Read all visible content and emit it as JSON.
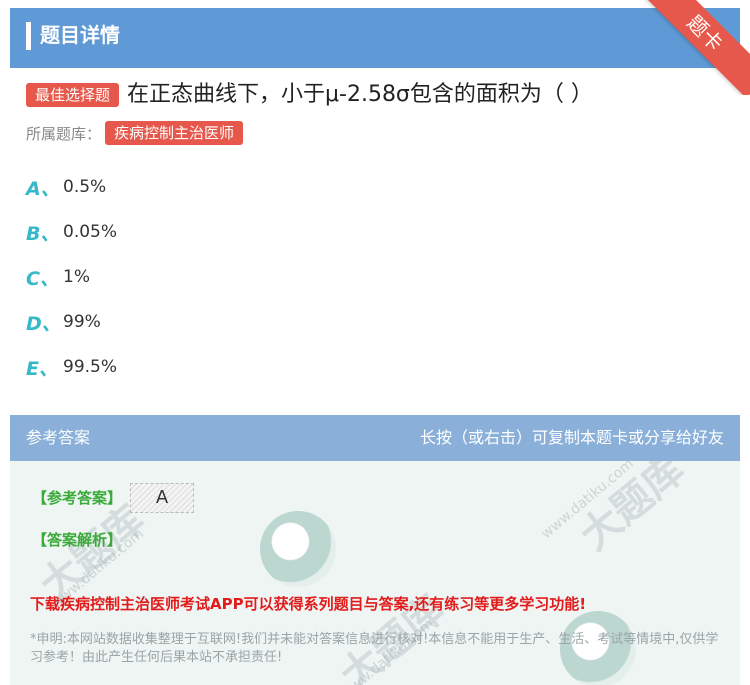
{
  "header": {
    "title": "题目详情",
    "ribbon": "题卡"
  },
  "question": {
    "type_badge": "最佳选择题",
    "text": "在正态曲线下，小于μ-2.58σ包含的面积为（ ）",
    "bank_label": "所属题库：",
    "bank_name": "疾病控制主治医师"
  },
  "options": [
    {
      "letter": "A、",
      "text": "0.5%"
    },
    {
      "letter": "B、",
      "text": "0.05%"
    },
    {
      "letter": "C、",
      "text": "1%"
    },
    {
      "letter": "D、",
      "text": "99%"
    },
    {
      "letter": "E、",
      "text": "99.5%"
    }
  ],
  "answer_section": {
    "title": "参考答案",
    "hint": "长按（或右击）可复制本题卡或分享给好友",
    "answer_label": "【参考答案】",
    "answer_value": "A",
    "analysis_label": "【答案解析】",
    "promo": "下载疾病控制主治医师考试APP可以获得系列题目与答案,还有练习等更多学习功能!",
    "disclaimer": "*申明:本网站数据收集整理于互联网!我们并未能对答案信息进行核对!本信息不能用于生产、生活、考试等情境中,仅供学习参考！由此产生任何后果本站不承担责任!"
  },
  "watermark": {
    "brand": "大题库",
    "url": "www.datiku.com"
  },
  "colors": {
    "header_blue": "#5f9ad6",
    "badge_red": "#e5584b",
    "option_teal": "#35b8c8",
    "answer_green": "#3aaa3a",
    "promo_red": "#e21b1b"
  }
}
